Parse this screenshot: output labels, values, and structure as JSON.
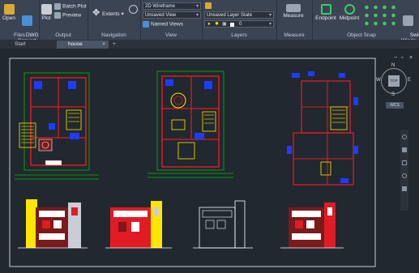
{
  "ribbon": {
    "files": {
      "label": "Files",
      "open_label": "Open",
      "dwg_convert_label": "DWG\nConvert"
    },
    "output": {
      "label": "Output",
      "plot_label": "Plot",
      "batch_plot_label": "Batch Plot",
      "preview_label": "Preview"
    },
    "navigation": {
      "label": "Navigation",
      "extents_label": "Extents"
    },
    "view": {
      "label": "View",
      "visual_style_value": "2D Wireframe",
      "view_value": "Unsaved View",
      "named_views_label": "Named Views"
    },
    "layers": {
      "label": "Layers",
      "layer_state_value": "Unsaved Layer State",
      "layer_value": "0"
    },
    "measure": {
      "label": "Measure",
      "measure_label": "Measure"
    },
    "object_snap": {
      "label": "Object Snap",
      "endpoint_label": "Endpoint",
      "midpoint_label": "Midpoint",
      "switch_label": "Switc\nWindo"
    }
  },
  "tabs": [
    {
      "label": "Start"
    },
    {
      "label": "house"
    }
  ],
  "add_tab_label": "+",
  "viewcube": {
    "north": "N",
    "south": "S",
    "west": "W",
    "east": "E",
    "top": "TOP",
    "wcs": "WCS"
  },
  "window_controls": {
    "minimize": "−",
    "restore": "▫",
    "close": "×"
  },
  "colors": {
    "ribbon": "#3b4453",
    "canvas": "#212830",
    "wall": "#e01b24",
    "dim": "#00c000",
    "door": "#ffe600",
    "furniture": "#ffffff",
    "annot": "#1e3cff"
  }
}
